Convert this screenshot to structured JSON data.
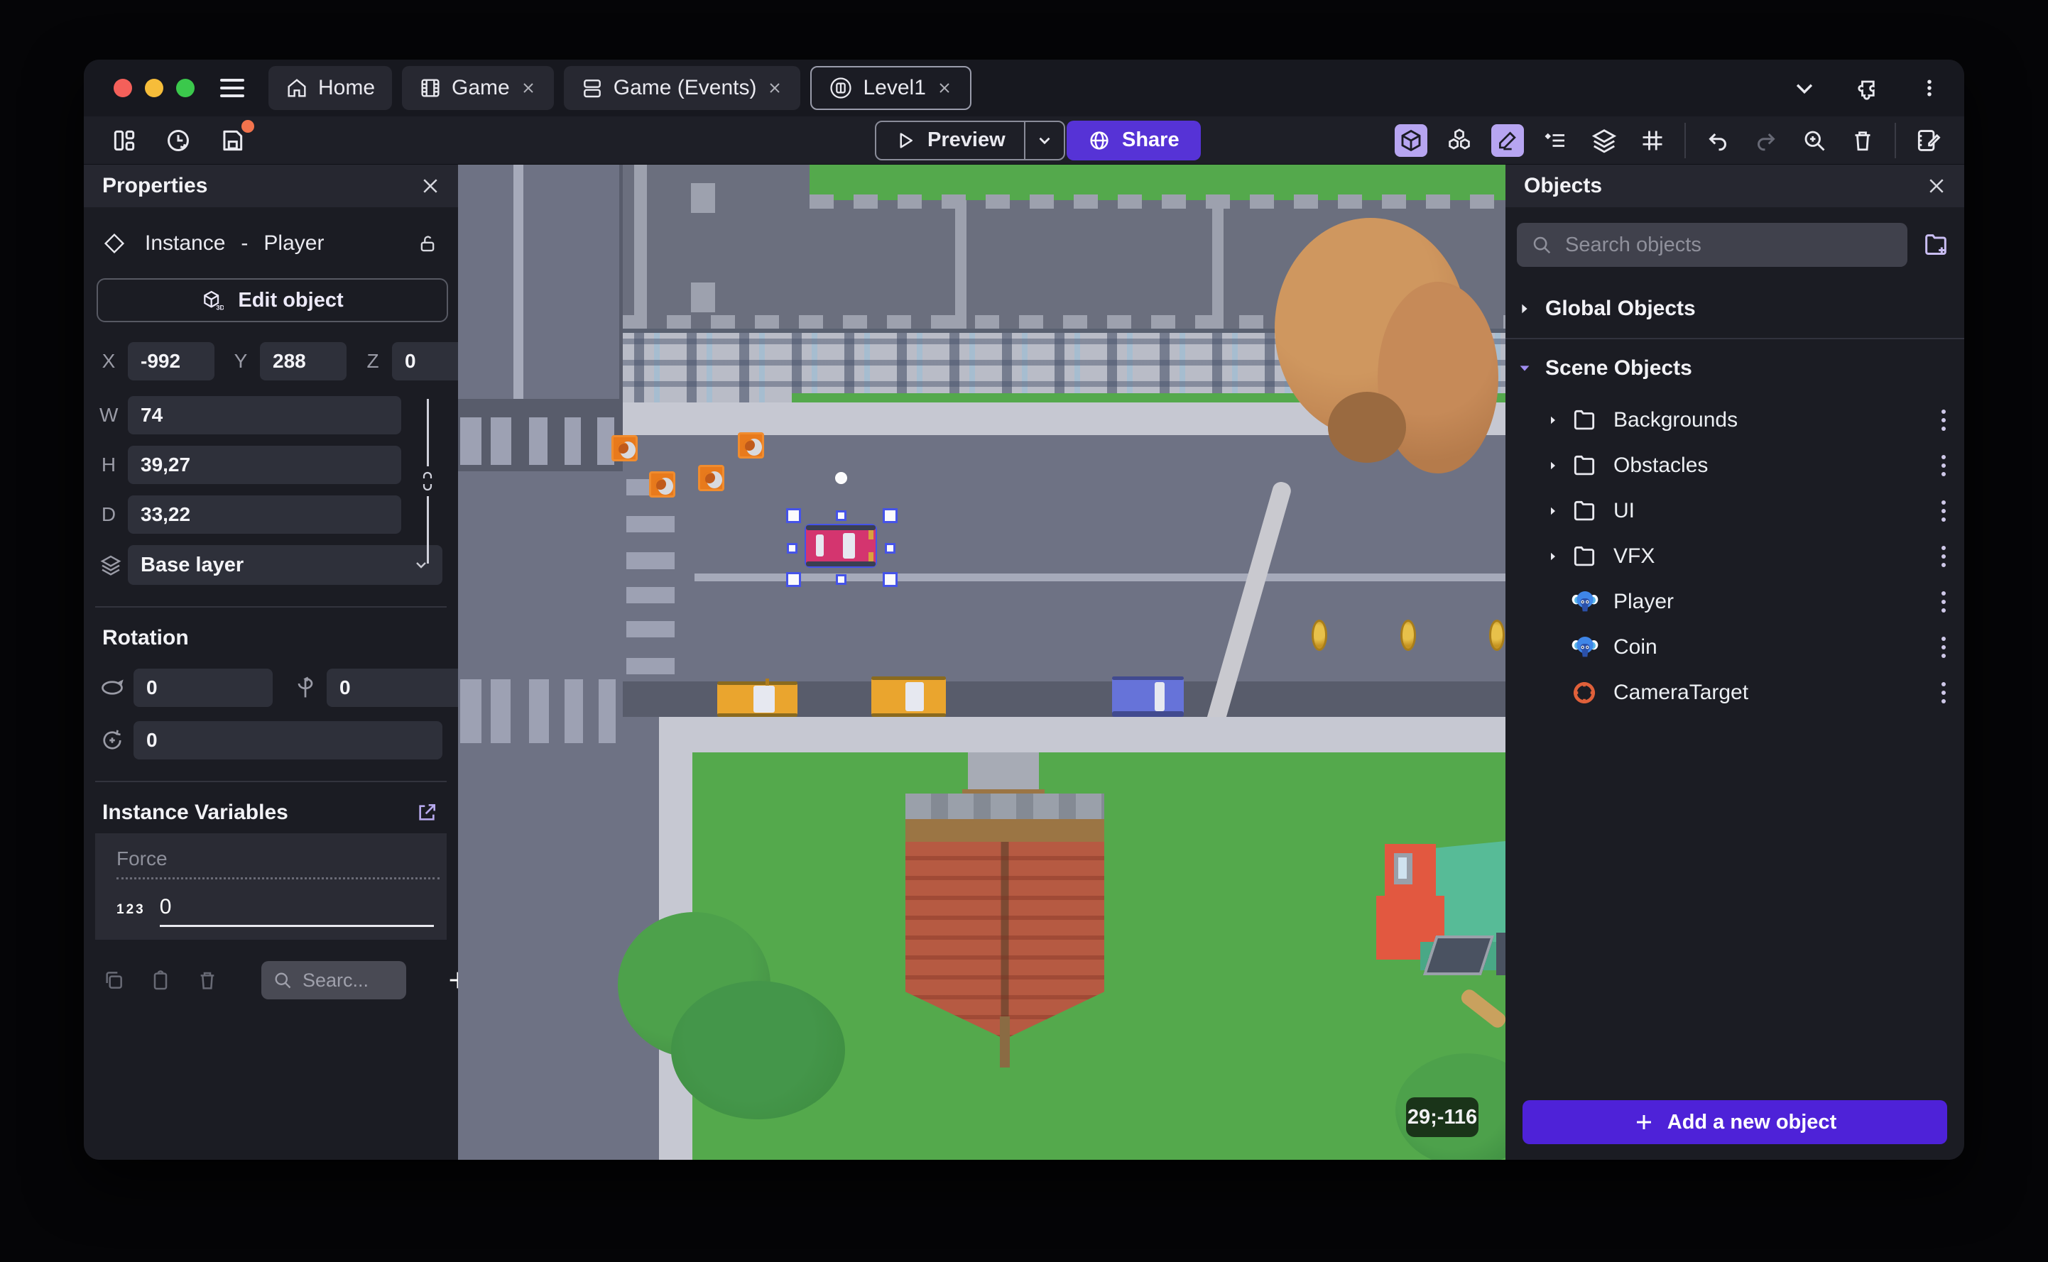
{
  "window": {
    "tabs": [
      {
        "label": "Home",
        "icon": "home-icon",
        "closable": false,
        "active": false
      },
      {
        "label": "Game",
        "icon": "film-icon",
        "closable": true,
        "active": false
      },
      {
        "label": "Game (Events)",
        "icon": "event-sheet-icon",
        "closable": true,
        "active": false
      },
      {
        "label": "Level1",
        "icon": "scene-icon",
        "closable": true,
        "active": true
      }
    ],
    "traffic_lights": {
      "close": "#f4605a",
      "minimize": "#f6bd3a",
      "zoom": "#3bc84c"
    },
    "right_icons": [
      "chevron-down-icon",
      "extensions-puzzle-icon",
      "kebab-menu-icon"
    ]
  },
  "toolbar": {
    "left_icons": [
      "layout-panels-icon",
      "history-clock-icon",
      "save-icon"
    ],
    "save_has_unsaved_dot": true,
    "preview_label": "Preview",
    "share_label": "Share",
    "right_icons": [
      "cube-3d-icon",
      "objects-cubes-icon",
      "pencil-edit-icon",
      "instance-list-icon",
      "layers-icon",
      "grid-icon",
      "undo-icon",
      "redo-icon",
      "zoom-in-icon",
      "trash-icon",
      "events-notebook-icon"
    ],
    "active_tools": [
      "cube-3d-icon",
      "pencil-edit-icon"
    ]
  },
  "properties": {
    "title": "Properties",
    "instance_type": "Instance",
    "separator": "-",
    "instance_name": "Player",
    "edit_object_label": "Edit object",
    "x_label": "X",
    "x_value": "-992",
    "y_label": "Y",
    "y_value": "288",
    "z_label": "Z",
    "z_value": "0",
    "w_label": "W",
    "w_value": "74",
    "h_label": "H",
    "h_value": "39,27",
    "d_label": "D",
    "d_value": "33,22",
    "layer_value": "Base layer",
    "rotation_title": "Rotation",
    "rotation_x": "0",
    "rotation_y": "0",
    "rotation_z": "0",
    "variables_title": "Instance Variables",
    "variable_name": "Force",
    "variable_type_badge": "123",
    "variable_value": "0",
    "variables_search_placeholder": "Searc..."
  },
  "objects": {
    "title": "Objects",
    "search_placeholder": "Search objects",
    "global_section": "Global Objects",
    "scene_section": "Scene Objects",
    "tree": [
      {
        "label": "Backgrounds",
        "icon": "folder-icon"
      },
      {
        "label": "Obstacles",
        "icon": "folder-icon"
      },
      {
        "label": "UI",
        "icon": "folder-icon"
      },
      {
        "label": "VFX",
        "icon": "folder-icon"
      },
      {
        "label": "Player",
        "icon": "monkey-thumbnail-icon"
      },
      {
        "label": "Coin",
        "icon": "monkey-thumbnail-icon"
      },
      {
        "label": "CameraTarget",
        "icon": "target-icon"
      }
    ],
    "add_button_label": "Add a new object"
  },
  "canvas": {
    "cursor_coordinates_badge": "29;-116",
    "selected_instance": "Player car (pink)",
    "entities": [
      "apartment-building",
      "orange-tree",
      "fallen-trunk",
      "pink-car-selected",
      "yellow-car",
      "yellow-car",
      "blue-car",
      "coin",
      "coin",
      "coin",
      "crate",
      "crate",
      "crate",
      "crate",
      "brick-tower",
      "teal-roof-house",
      "green-tree",
      "green-tree",
      "crosswalks",
      "roads",
      "grass"
    ]
  },
  "colors": {
    "accent_purple": "#5633d6",
    "add_button_purple": "#4e22d8",
    "active_tool_background": "#b7a5f1",
    "unsaved_dot_orange": "#f2734d",
    "selection_blue": "#4553e8",
    "grass_green": "#54a94c",
    "road_gray": "#6e7284"
  }
}
